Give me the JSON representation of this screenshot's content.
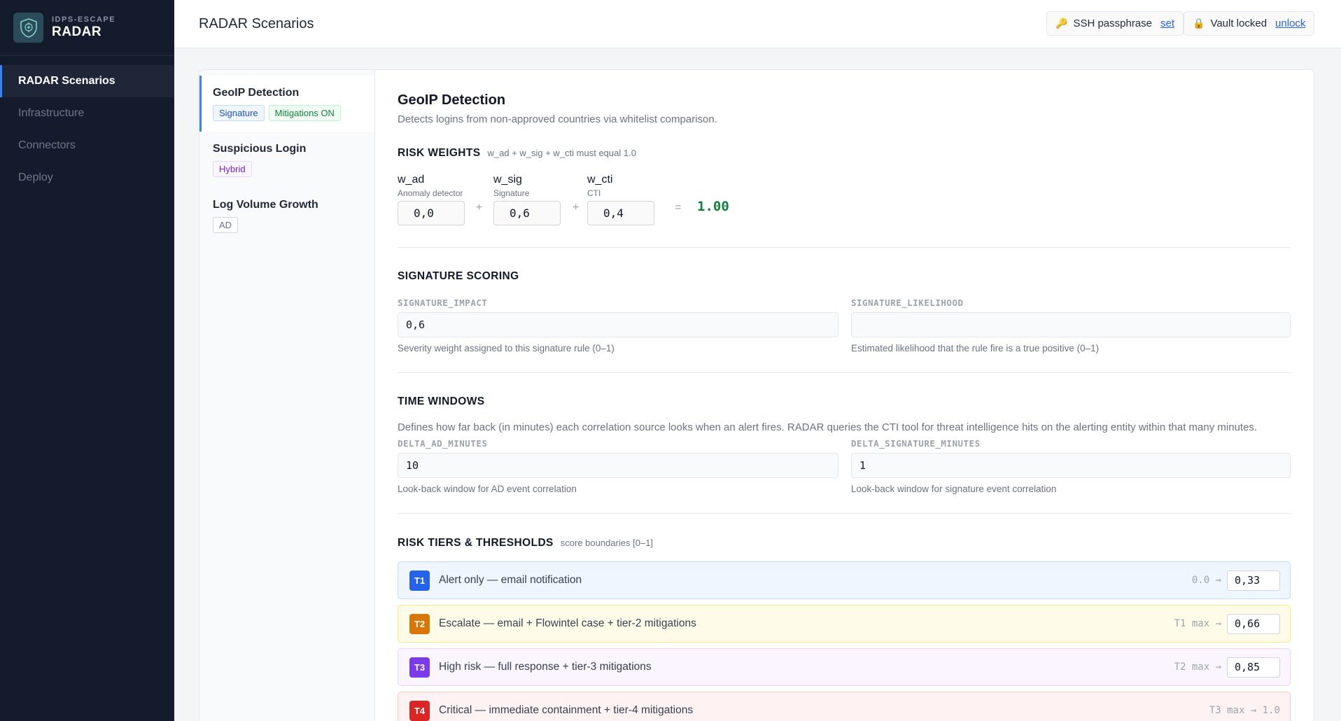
{
  "brand": {
    "sub": "IDPS-ESCAPE",
    "title": "RADAR",
    "logo_icon": "shield-icon"
  },
  "nav": [
    {
      "label": "RADAR Scenarios",
      "active": true
    },
    {
      "label": "Infrastructure",
      "active": false
    },
    {
      "label": "Connectors",
      "active": false
    },
    {
      "label": "Deploy",
      "active": false
    }
  ],
  "header": {
    "title": "RADAR Scenarios",
    "ssh": {
      "icon": "key-icon",
      "label": "SSH passphrase",
      "link": "set"
    },
    "vault": {
      "icon": "lock-icon",
      "label": "Vault locked",
      "link": "unlock"
    }
  },
  "scenarios": [
    {
      "name": "GeoIP Detection",
      "tags": [
        "Signature",
        "Mitigations ON"
      ],
      "active": true
    },
    {
      "name": "Suspicious Login",
      "tags": [
        "Hybrid"
      ],
      "active": false
    },
    {
      "name": "Log Volume Growth",
      "tags": [
        "AD"
      ],
      "active": false
    }
  ],
  "detail": {
    "title": "GeoIP Detection",
    "description": "Detects logins from non-approved countries via whitelist comparison.",
    "risk_weights": {
      "title": "RISK WEIGHTS",
      "hint": "w_ad + w_sig + w_cti must equal 1.0",
      "weights": [
        {
          "name": "w_ad",
          "sub": "Anomaly detector",
          "value": "0,0"
        },
        {
          "name": "w_sig",
          "sub": "Signature",
          "value": "0,6"
        },
        {
          "name": "w_cti",
          "sub": "CTI",
          "value": "0,4"
        }
      ],
      "plus": "+",
      "equals": "=",
      "sum": "1.00"
    },
    "signature_scoring": {
      "title": "SIGNATURE SCORING",
      "impact": {
        "label": "SIGNATURE_IMPACT",
        "value": "0,6",
        "help": "Severity weight assigned to this signature rule (0–1)"
      },
      "likelihood": {
        "label": "SIGNATURE_LIKELIHOOD",
        "value": "",
        "help": "Estimated likelihood that the rule fire is a true positive (0–1)"
      }
    },
    "time_windows": {
      "title": "TIME WINDOWS",
      "description": "Defines how far back (in minutes) each correlation source looks when an alert fires. RADAR queries the CTI tool for threat intelligence hits on the alerting entity within that many minutes.",
      "ad": {
        "label": "DELTA_AD_MINUTES",
        "value": "10",
        "help": "Look-back window for AD event correlation"
      },
      "sig": {
        "label": "DELTA_SIGNATURE_MINUTES",
        "value": "1",
        "help": "Look-back window for signature event correlation"
      }
    },
    "tiers": {
      "title": "RISK TIERS & THRESHOLDS",
      "hint": "score boundaries [0–1]",
      "items": [
        {
          "badge": "T1",
          "text": "Alert only — email notification",
          "range": "0.0 →",
          "value": "0,33",
          "color": "#2563eb",
          "bg": "#eff6ff",
          "border": "#bfdbfe"
        },
        {
          "badge": "T2",
          "text": "Escalate — email + Flowintel case + tier-2 mitigations",
          "range": "T1 max →",
          "value": "0,66",
          "color": "#d97706",
          "bg": "#fefce8",
          "border": "#fde68a"
        },
        {
          "badge": "T3",
          "text": "High risk — full response + tier-3 mitigations",
          "range": "T2 max →",
          "value": "0,85",
          "color": "#7c3aed",
          "bg": "#faf5ff",
          "border": "#e9d5ff"
        },
        {
          "badge": "T4",
          "text": "Critical — immediate containment + tier-4 mitigations",
          "range": "T3 max → 1.0",
          "value": "",
          "color": "#dc2626",
          "bg": "#fef2f2",
          "border": "#fecaca"
        }
      ]
    }
  }
}
